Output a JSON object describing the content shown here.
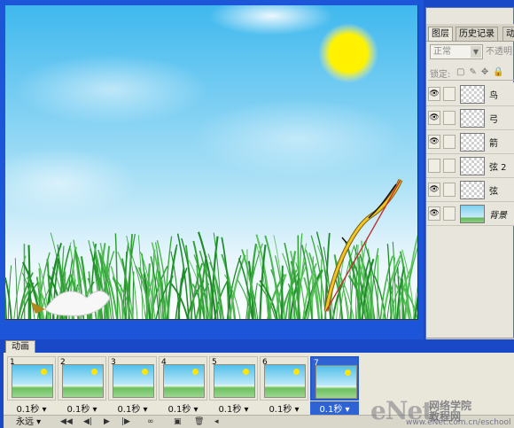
{
  "layers_panel": {
    "tabs": [
      "图层",
      "历史记录",
      "动"
    ],
    "blend_mode": "正常",
    "opacity_label": "不透明",
    "lock_label": "锁定:",
    "layers": [
      {
        "name": "鸟",
        "visible": true,
        "thumb": "transparent"
      },
      {
        "name": "弓",
        "visible": true,
        "thumb": "transparent"
      },
      {
        "name": "箭",
        "visible": true,
        "thumb": "transparent"
      },
      {
        "name": "弦 2",
        "visible": false,
        "thumb": "transparent"
      },
      {
        "name": "弦",
        "visible": true,
        "thumb": "transparent"
      },
      {
        "name": "背景",
        "visible": true,
        "thumb": "background"
      }
    ]
  },
  "animation_panel": {
    "tab_label": "动画",
    "frames": [
      {
        "number": "1",
        "delay": "0.1秒"
      },
      {
        "number": "2",
        "delay": "0.1秒"
      },
      {
        "number": "3",
        "delay": "0.1秒"
      },
      {
        "number": "4",
        "delay": "0.1秒"
      },
      {
        "number": "5",
        "delay": "0.1秒"
      },
      {
        "number": "6",
        "delay": "0.1秒"
      },
      {
        "number": "7",
        "delay": "0.1秒",
        "selected": true
      }
    ],
    "loop_option": "永远"
  },
  "watermark": {
    "brand": "eNet",
    "cn_line1": "网络学院",
    "cn_line2": "教程网",
    "url": "www.eNet.com.cn/eschool"
  },
  "colors": {
    "window_blue": "#0a47d6",
    "sky": "#5cc6ee",
    "sun": "#ffea00",
    "grass": "#3fae3a",
    "selected_frame": "#2f62d2"
  }
}
